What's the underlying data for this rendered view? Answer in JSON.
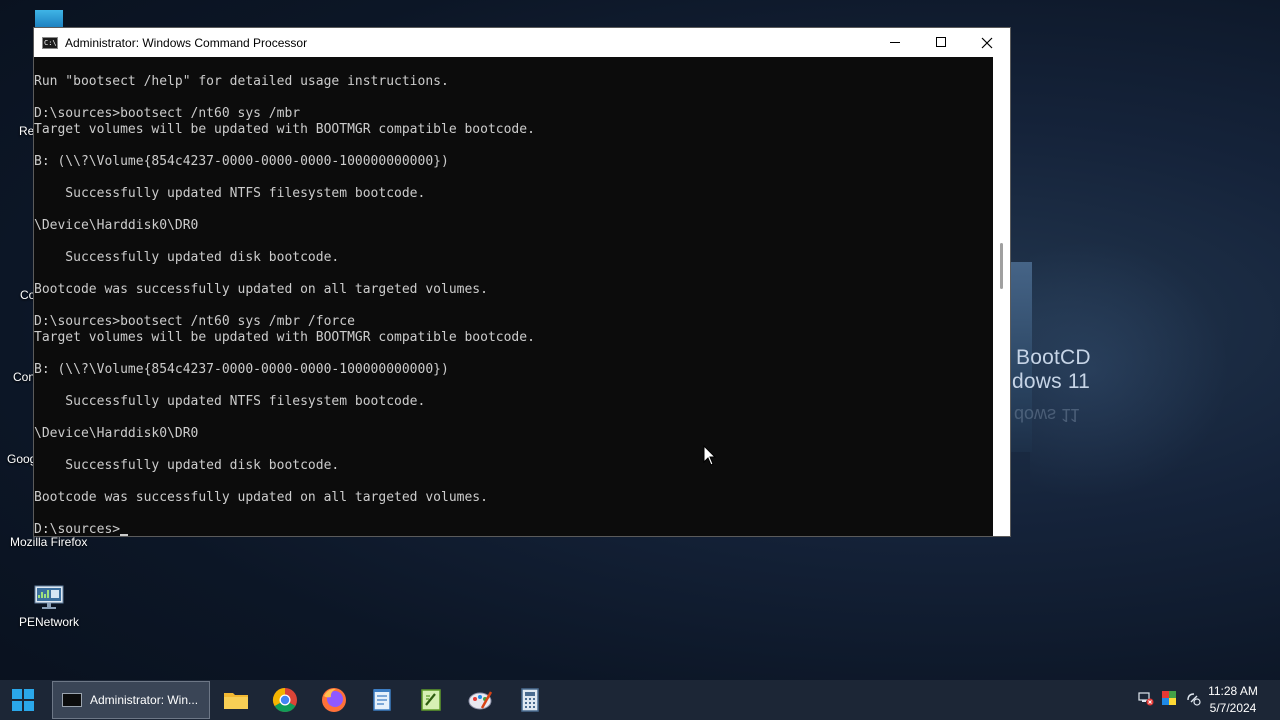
{
  "desktop": {
    "wallpaper_text": [
      "BootCD",
      "dows 11"
    ],
    "wallpaper_reflection": "dows 11",
    "partial_icon_labels": [
      "Re",
      "Co",
      "Con",
      "Goog",
      "Mozilla Firefox"
    ],
    "icons": [
      {
        "label": "PENetwork",
        "icon": "network-monitor-icon"
      }
    ]
  },
  "window": {
    "title": "Administrator: Windows Command Processor",
    "controls": {
      "minimize": "minimize-icon",
      "maximize": "maximize-icon",
      "close": "close-icon"
    },
    "console_lines": [
      "Run \"bootsect /help\" for detailed usage instructions.",
      "",
      "D:\\sources>bootsect /nt60 sys /mbr",
      "Target volumes will be updated with BOOTMGR compatible bootcode.",
      "",
      "B: (\\\\?\\Volume{854c4237-0000-0000-0000-100000000000})",
      "",
      "    Successfully updated NTFS filesystem bootcode.",
      "",
      "\\Device\\Harddisk0\\DR0",
      "",
      "    Successfully updated disk bootcode.",
      "",
      "Bootcode was successfully updated on all targeted volumes.",
      "",
      "D:\\sources>bootsect /nt60 sys /mbr /force",
      "Target volumes will be updated with BOOTMGR compatible bootcode.",
      "",
      "B: (\\\\?\\Volume{854c4237-0000-0000-0000-100000000000})",
      "",
      "    Successfully updated NTFS filesystem bootcode.",
      "",
      "\\Device\\Harddisk0\\DR0",
      "",
      "    Successfully updated disk bootcode.",
      "",
      "Bootcode was successfully updated on all targeted volumes.",
      "",
      "D:\\sources>"
    ]
  },
  "taskbar": {
    "start_icon": "windows-start-icon",
    "active_task": "Administrator: Win...",
    "pinned": [
      "folder-icon",
      "chrome-icon",
      "firefox-icon",
      "notepad-icon",
      "notepadpp-icon",
      "paint-icon",
      "calculator-icon"
    ],
    "tray": [
      "network-error-icon",
      "color-icon",
      "connection-icon"
    ],
    "clock": {
      "time": "11:28 AM",
      "date": "5/7/2024"
    }
  },
  "colors": {
    "console_bg": "#0c0c0c",
    "console_fg": "#cccccc",
    "taskbar_bg": "#1c2636"
  }
}
